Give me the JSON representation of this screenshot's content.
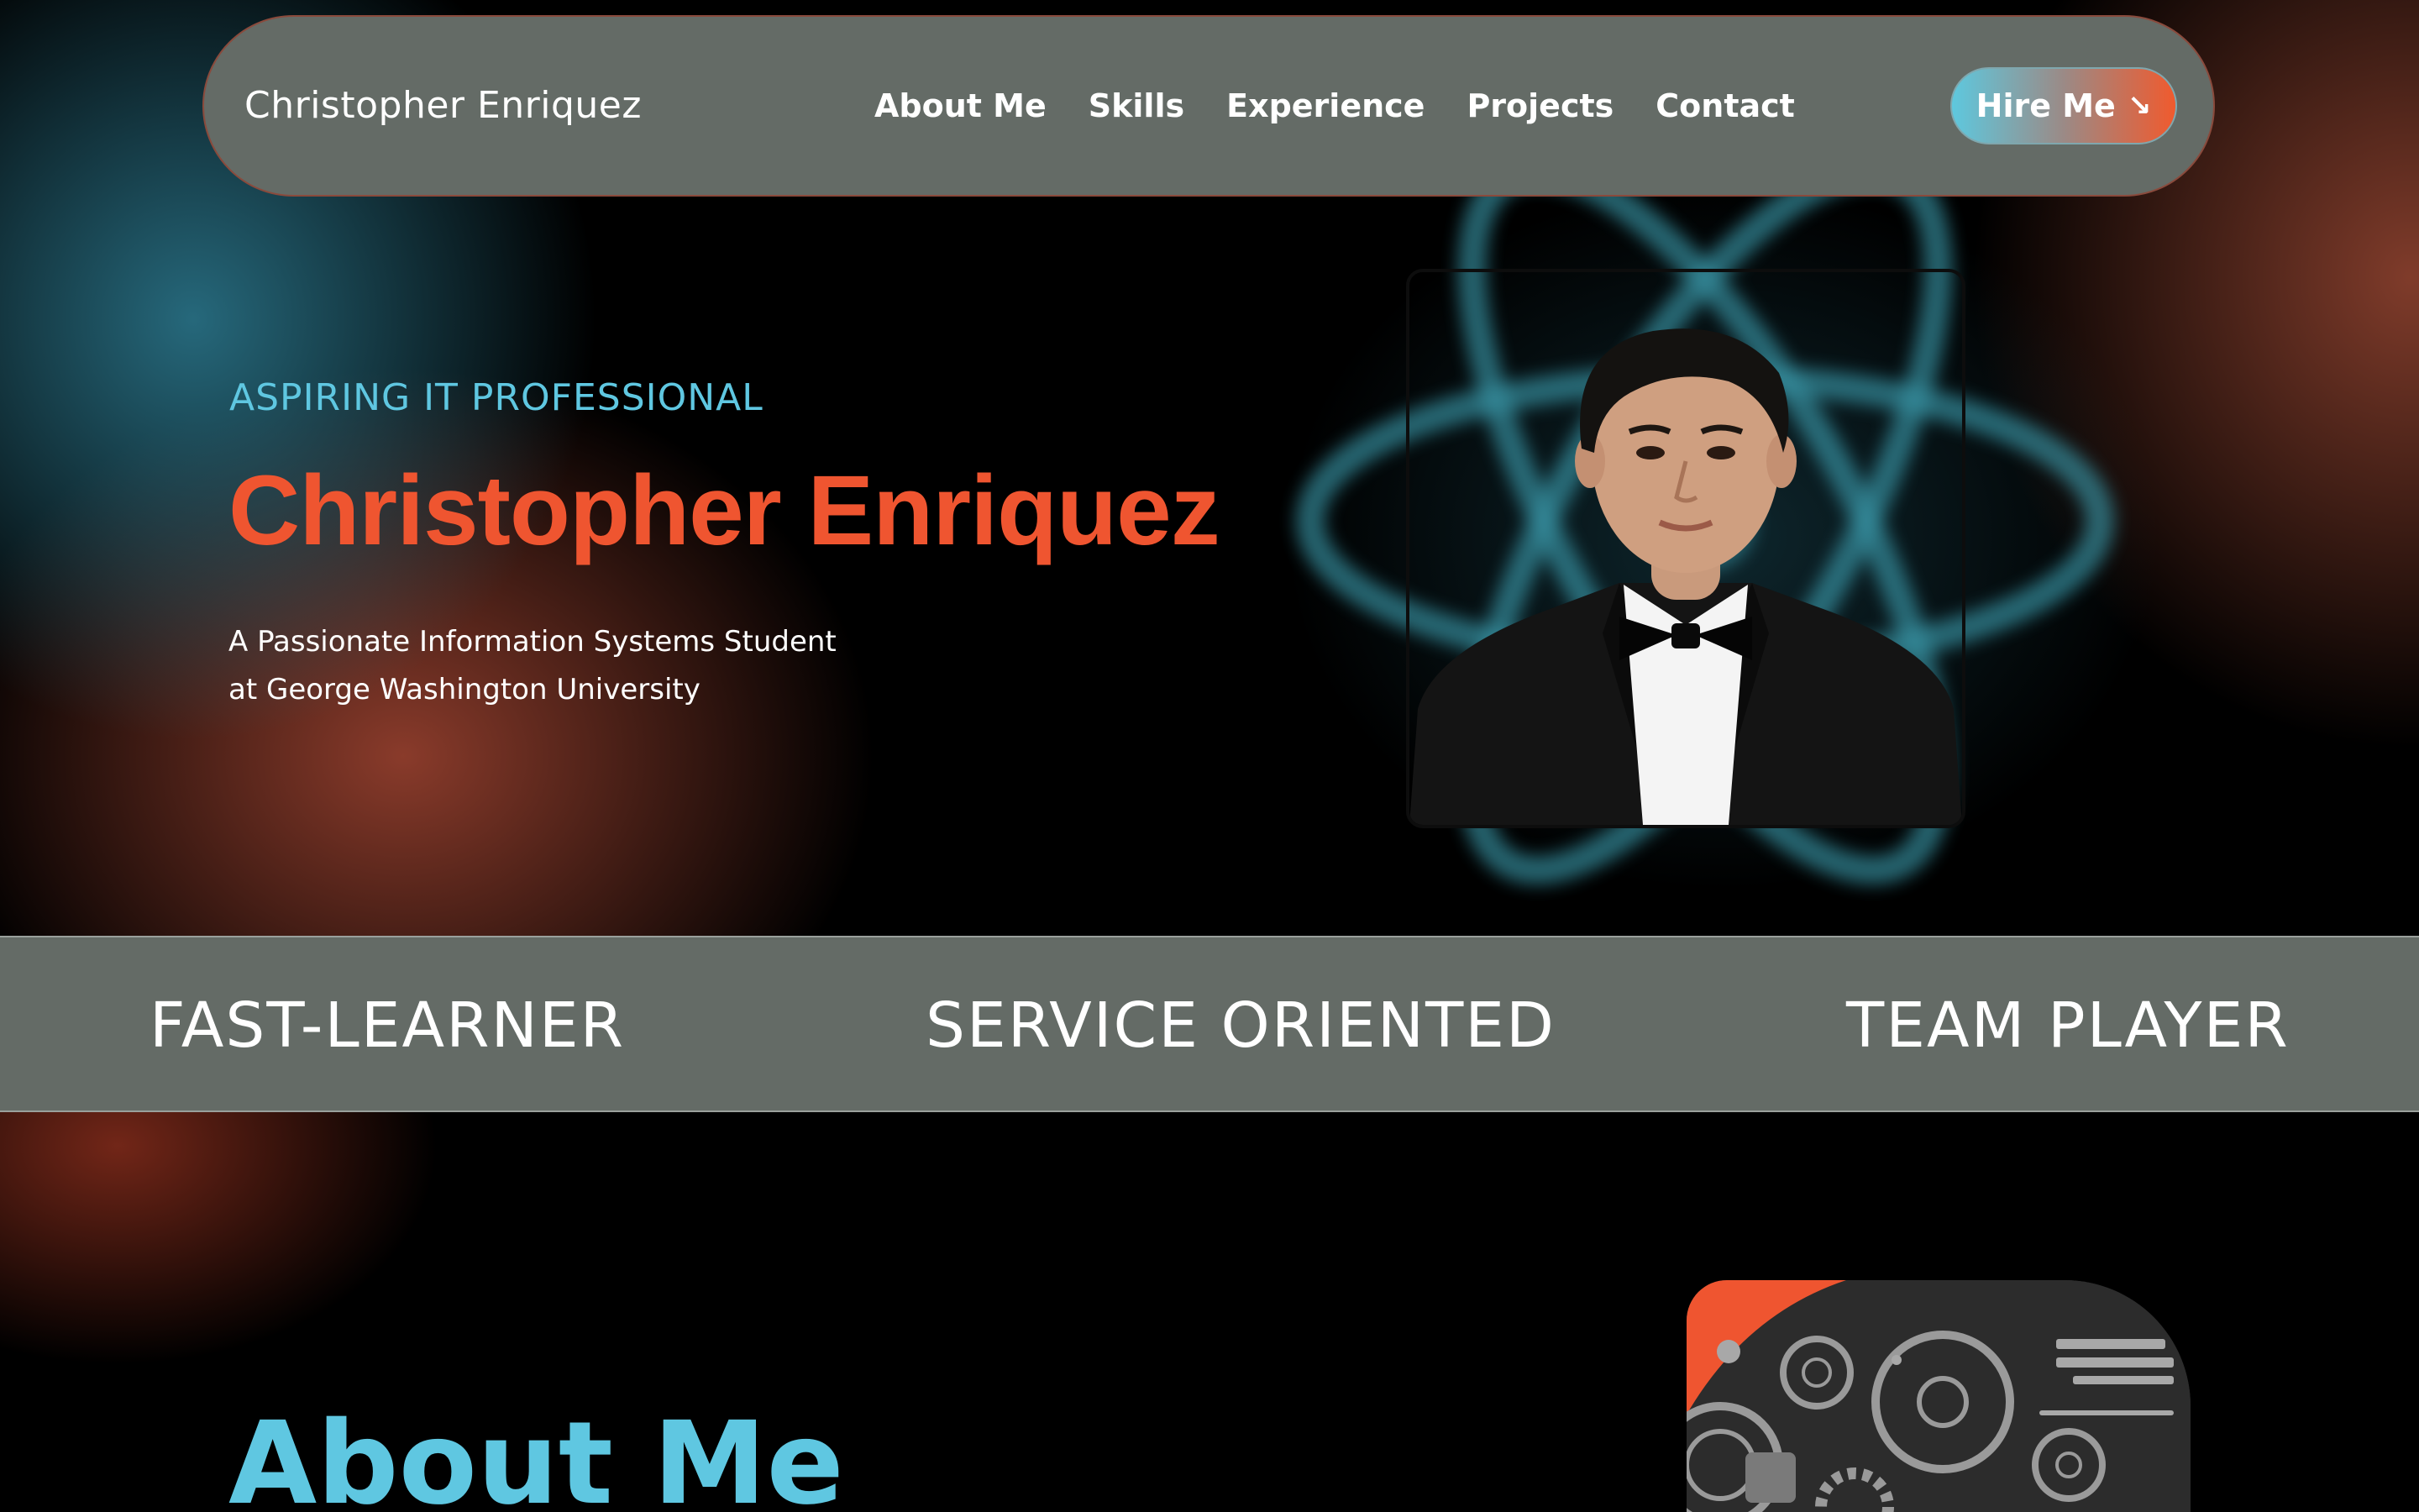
{
  "nav": {
    "brand": "Christopher Enriquez",
    "links": [
      "About Me",
      "Skills",
      "Experience",
      "Projects",
      "Contact"
    ],
    "cta": "Hire Me",
    "cta_icon": "arrow-down-right-icon"
  },
  "hero": {
    "tagline": "ASPIRING IT PROFESSIONAL",
    "name": "Christopher Enriquez",
    "description_line1": "A Passionate Information Systems Student",
    "description_line2": "at George Washington University",
    "background_icon": "atom-icon",
    "photo": "portrait-photo"
  },
  "traits": [
    "FAST-LEARNER",
    "SERVICE ORIENTED",
    "TEAM PLAYER"
  ],
  "about": {
    "title": "About Me",
    "image": "tech-gears-illustration"
  },
  "colors": {
    "accent_orange": "#ef5530",
    "accent_cyan": "#5fc7e1",
    "nav_bg": "#646b66",
    "page_bg": "#000000"
  }
}
